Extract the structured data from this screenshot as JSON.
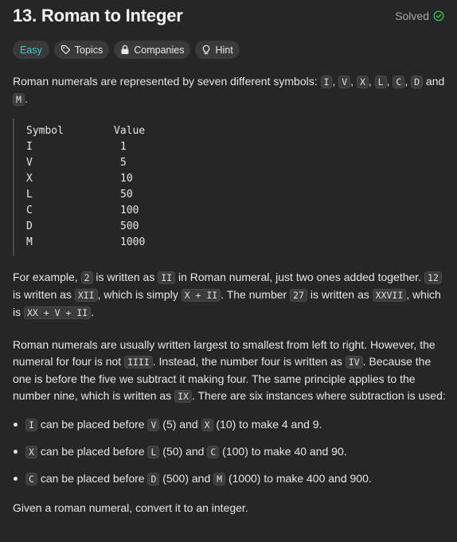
{
  "header": {
    "title": "13. Roman to Integer",
    "status": "Solved"
  },
  "tags": {
    "difficulty": "Easy",
    "topics": "Topics",
    "companies": "Companies",
    "hint": "Hint"
  },
  "intro": {
    "text": "Roman numerals are represented by seven different symbols: ",
    "symbols": [
      "I",
      "V",
      "X",
      "L",
      "C",
      "D",
      "M"
    ],
    "sep": ", ",
    "and": " and ",
    "end": "."
  },
  "table": {
    "header": [
      "Symbol",
      "Value"
    ],
    "rows": [
      [
        "I",
        "1"
      ],
      [
        "V",
        "5"
      ],
      [
        "X",
        "10"
      ],
      [
        "L",
        "50"
      ],
      [
        "C",
        "100"
      ],
      [
        "D",
        "500"
      ],
      [
        "M",
        "1000"
      ]
    ]
  },
  "example": {
    "t1": "For example, ",
    "c1": "2",
    "t2": " is written as ",
    "c2": "II",
    "t3": " in Roman numeral, just two ones added together. ",
    "c3": "12",
    "t4": " is written as ",
    "c4": "XII",
    "t5": ", which is simply ",
    "c5": "X + II",
    "t6": ". The number ",
    "c6": "27",
    "t7": " is written as ",
    "c7": "XXVII",
    "t8": ", which is ",
    "c8": "XX + V + II",
    "t9": "."
  },
  "ordering": {
    "t1": "Roman numerals are usually written largest to smallest from left to right. However, the numeral for four is not ",
    "c1": "IIII",
    "t2": ". Instead, the number four is written as ",
    "c2": "IV",
    "t3": ". Because the one is before the five we subtract it making four. The same principle applies to the number nine, which is written as ",
    "c3": "IX",
    "t4": ". There are six instances where subtraction is used:"
  },
  "rules": [
    {
      "a": "I",
      "t1": " can be placed before ",
      "b": "V",
      "t2": " (5) and ",
      "c": "X",
      "t3": " (10) to make 4 and 9."
    },
    {
      "a": "X",
      "t1": " can be placed before ",
      "b": "L",
      "t2": " (50) and ",
      "c": "C",
      "t3": " (100) to make 40 and 90."
    },
    {
      "a": "C",
      "t1": " can be placed before ",
      "b": "D",
      "t2": " (500) and ",
      "c": "M",
      "t3": " (1000) to make 400 and 900."
    }
  ],
  "task": "Given a roman numeral, convert it to an integer."
}
